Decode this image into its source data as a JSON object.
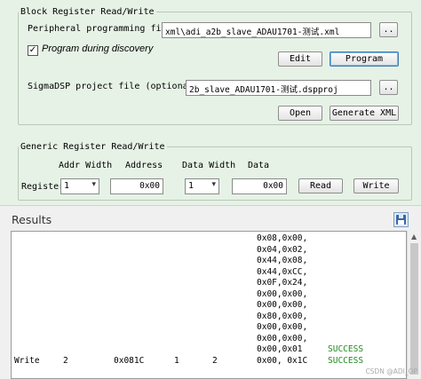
{
  "block_register": {
    "legend": "Block Register Read/Write",
    "peripheral_label": "Peripheral programming file",
    "peripheral_value": "xml\\adi_a2b_slave_ADAU1701-测试.xml",
    "browse_label": "..",
    "program_checkbox_label": "Program during discovery",
    "program_checked": true,
    "edit_label": "Edit",
    "program_label": "Program",
    "sigma_label": "SigmaDSP project file (optional)",
    "sigma_value": "2b_slave_ADAU1701-测试.dspproj",
    "open_label": "Open",
    "generate_xml_label": "Generate XML"
  },
  "generic_register": {
    "legend": "Generic Register Read/Write",
    "addr_width_header": "Addr Width",
    "address_header": "Address",
    "data_width_header": "Data Width",
    "data_header": "Data",
    "register_label": "Register",
    "addr_width_value": "1",
    "address_value": "0x00",
    "data_width_value": "1",
    "data_value": "0x00",
    "read_label": "Read",
    "write_label": "Write"
  },
  "results": {
    "title": "Results",
    "data_lines": [
      "0x08,0x00,",
      "0x04,0x02,",
      "0x44,0x08,",
      "0x44,0xCC,",
      "0x0F,0x24,",
      "0x00,0x00,",
      "0x00,0x00,",
      "0x80,0x00,",
      "0x00,0x00,",
      "0x00,0x00,",
      "0x00,0x01"
    ],
    "status_line": "SUCCESS",
    "last_row": {
      "op": "Write",
      "addr_width": "2",
      "address": "0x081C",
      "data_width": "1",
      "count": "2",
      "data": "0x00, 0x1C",
      "status": "SUCCESS"
    }
  },
  "watermark": "CSDN @ADI_OP"
}
